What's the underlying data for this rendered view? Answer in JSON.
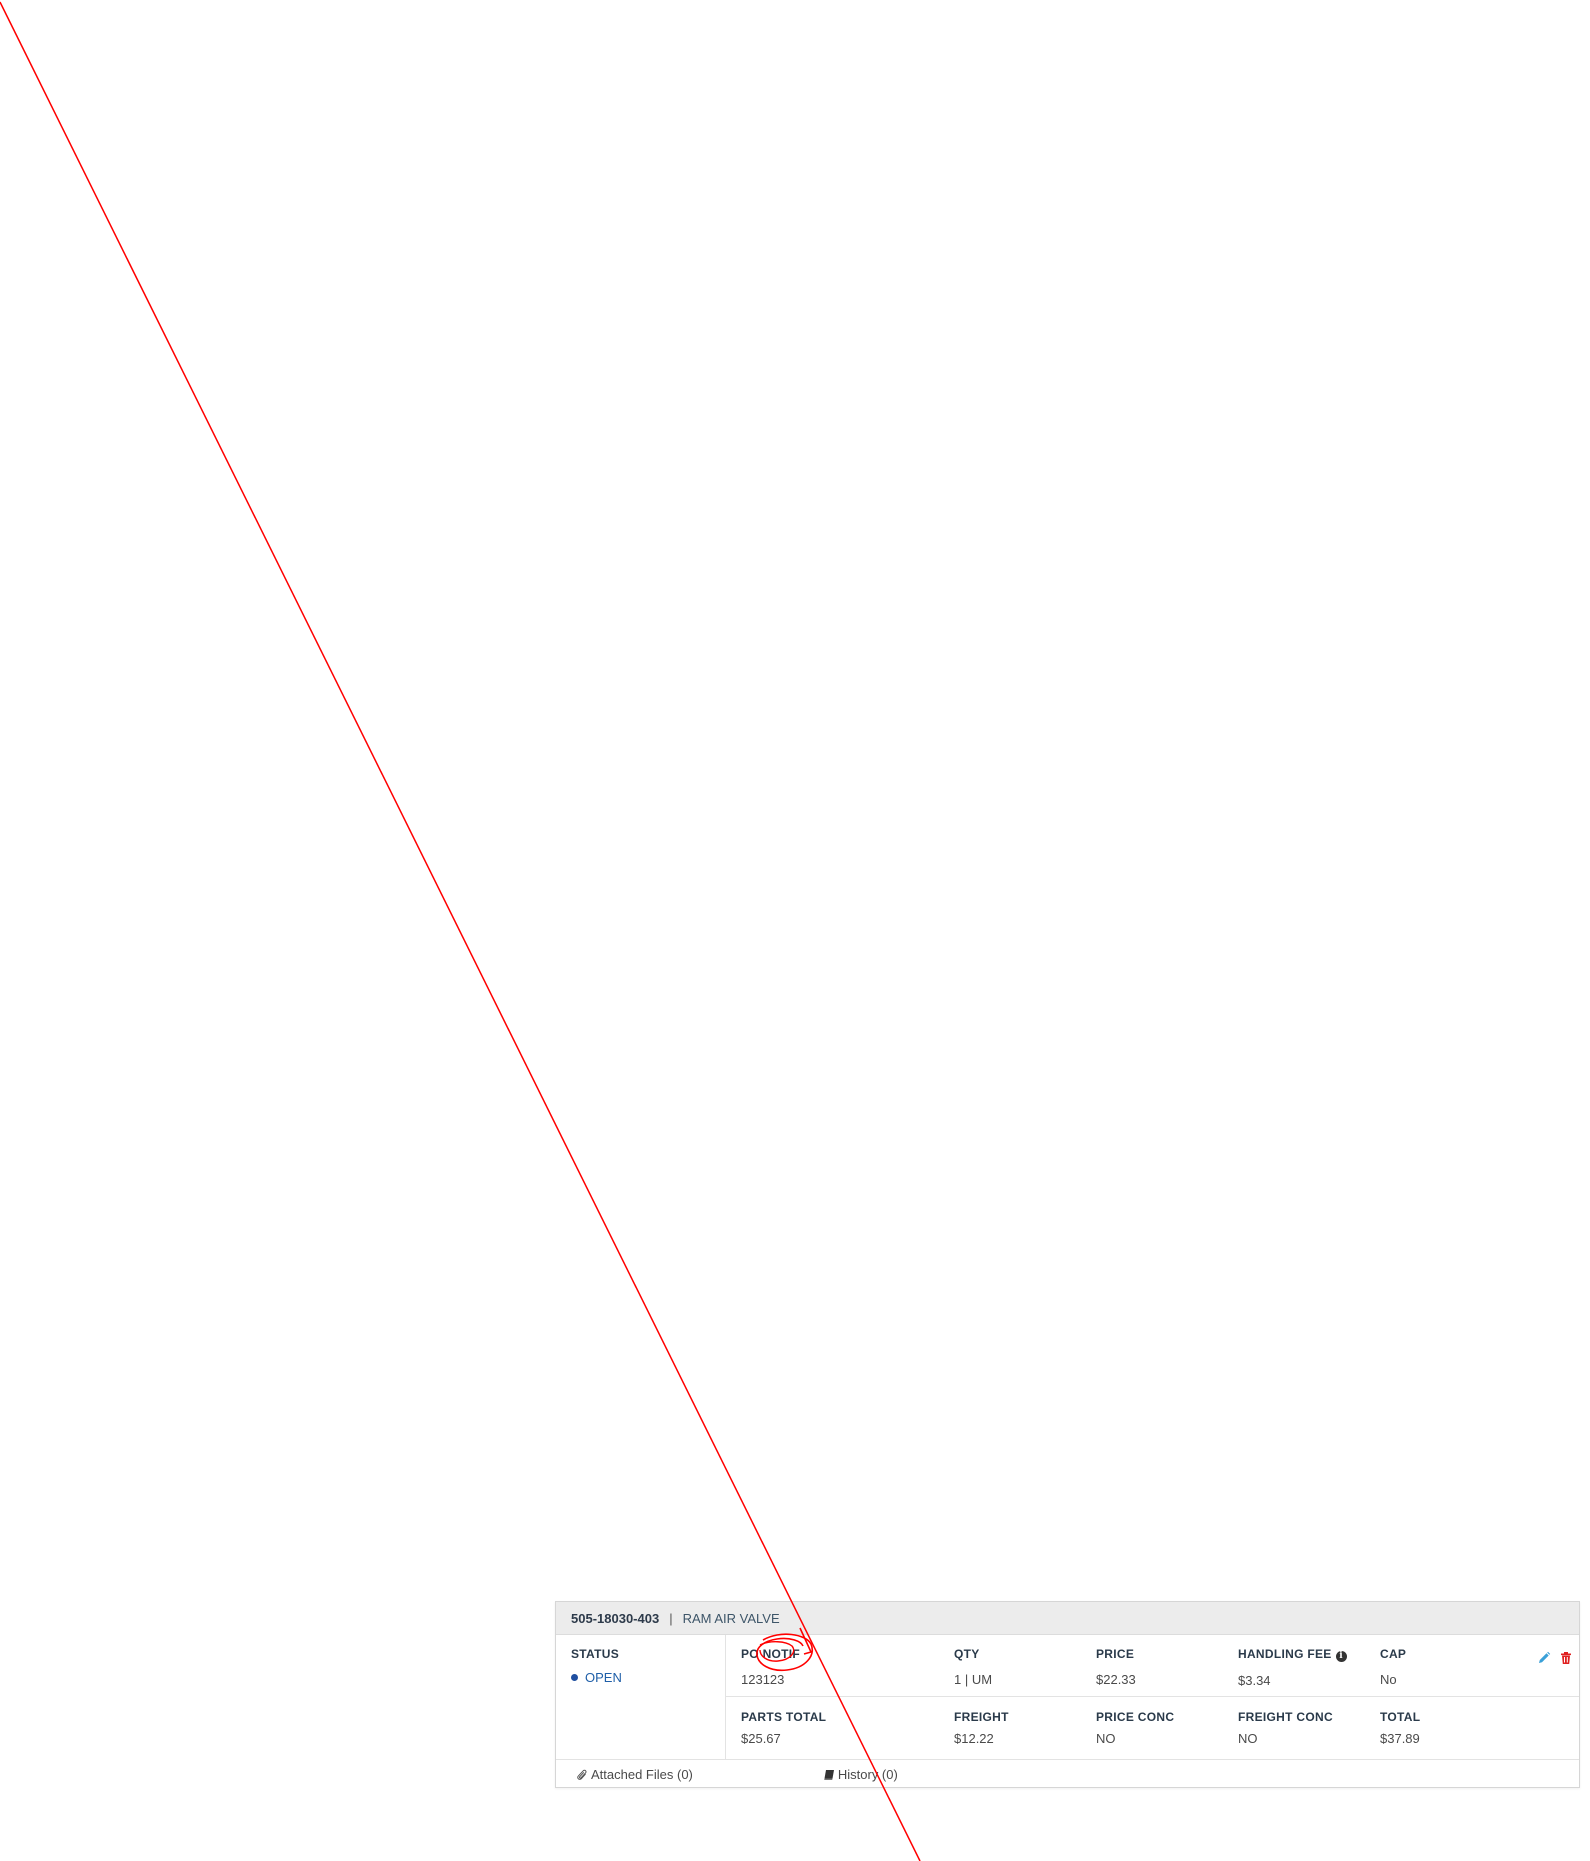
{
  "item": {
    "part_number": "505-18030-403",
    "separator": "|",
    "description": "RAM AIR VALVE"
  },
  "status": {
    "label": "STATUS",
    "value": "OPEN",
    "color": "#1f4fa0"
  },
  "fields_row1": [
    {
      "label": "PO NOTIF",
      "value": "123123"
    },
    {
      "label": "QTY",
      "value": "1 | UM"
    },
    {
      "label": "PRICE",
      "value": "$22.33"
    },
    {
      "label": "HANDLING FEE",
      "value": "$3.34"
    },
    {
      "label": "CAP",
      "value": "No"
    }
  ],
  "fields_row2": [
    {
      "label": "PARTS TOTAL",
      "value": "$25.67"
    },
    {
      "label": "FREIGHT",
      "value": "$12.22"
    },
    {
      "label": "PRICE CONC",
      "value": "NO"
    },
    {
      "label": "FREIGHT CONC",
      "value": "NO"
    },
    {
      "label": "TOTAL",
      "value": "$37.89"
    }
  ],
  "footer": {
    "attached_files": "Attached Files (0)",
    "history": "History (0)"
  },
  "actions": {
    "edit_icon": "pencil-icon",
    "delete_icon": "trash-icon",
    "edit_color": "#3aa0d8",
    "delete_color": "#e02020"
  },
  "annotation": {
    "color": "#ff0000",
    "shapes": [
      "line",
      "circle",
      "arrow"
    ]
  }
}
